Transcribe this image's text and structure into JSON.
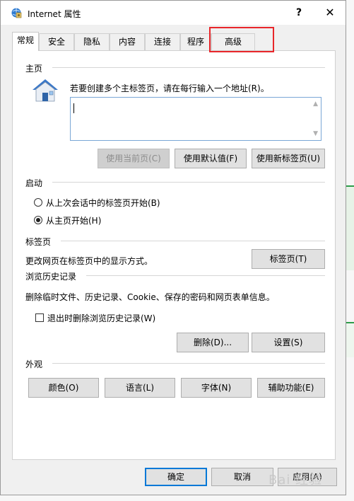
{
  "window": {
    "title": "Internet 属性",
    "help": "?",
    "close": "✕"
  },
  "tabs": [
    {
      "label": "常规",
      "active": true
    },
    {
      "label": "安全"
    },
    {
      "label": "隐私"
    },
    {
      "label": "内容"
    },
    {
      "label": "连接"
    },
    {
      "label": "程序"
    },
    {
      "label": "高级"
    }
  ],
  "home": {
    "group": "主页",
    "instruction": "若要创建多个主标签页，请在每行输入一个地址(R)。",
    "address_value": "",
    "use_current": "使用当前页(C)",
    "use_default": "使用默认值(F)",
    "use_new_tab": "使用新标签页(U)"
  },
  "startup": {
    "group": "启动",
    "option_last_session": "从上次会话中的标签页开始(B)",
    "option_home": "从主页开始(H)",
    "selected": "option_home"
  },
  "tabs_section": {
    "group": "标签页",
    "description": "更改网页在标签页中的显示方式。",
    "button": "标签页(T)"
  },
  "history": {
    "group": "浏览历史记录",
    "description": "删除临时文件、历史记录、Cookie、保存的密码和网页表单信息。",
    "checkbox_label": "退出时删除浏览历史记录(W)",
    "checked": false,
    "delete_button": "删除(D)...",
    "settings_button": "设置(S)"
  },
  "appearance": {
    "group": "外观",
    "colors": "颜色(O)",
    "languages": "语言(L)",
    "fonts": "字体(N)",
    "accessibility": "辅助功能(E)"
  },
  "footer": {
    "ok": "确定",
    "cancel": "取消",
    "apply": "应用(A)"
  },
  "watermark": "Bai 经验",
  "colors": {
    "highlight": "#e8262a",
    "accent": "#0078d7"
  }
}
